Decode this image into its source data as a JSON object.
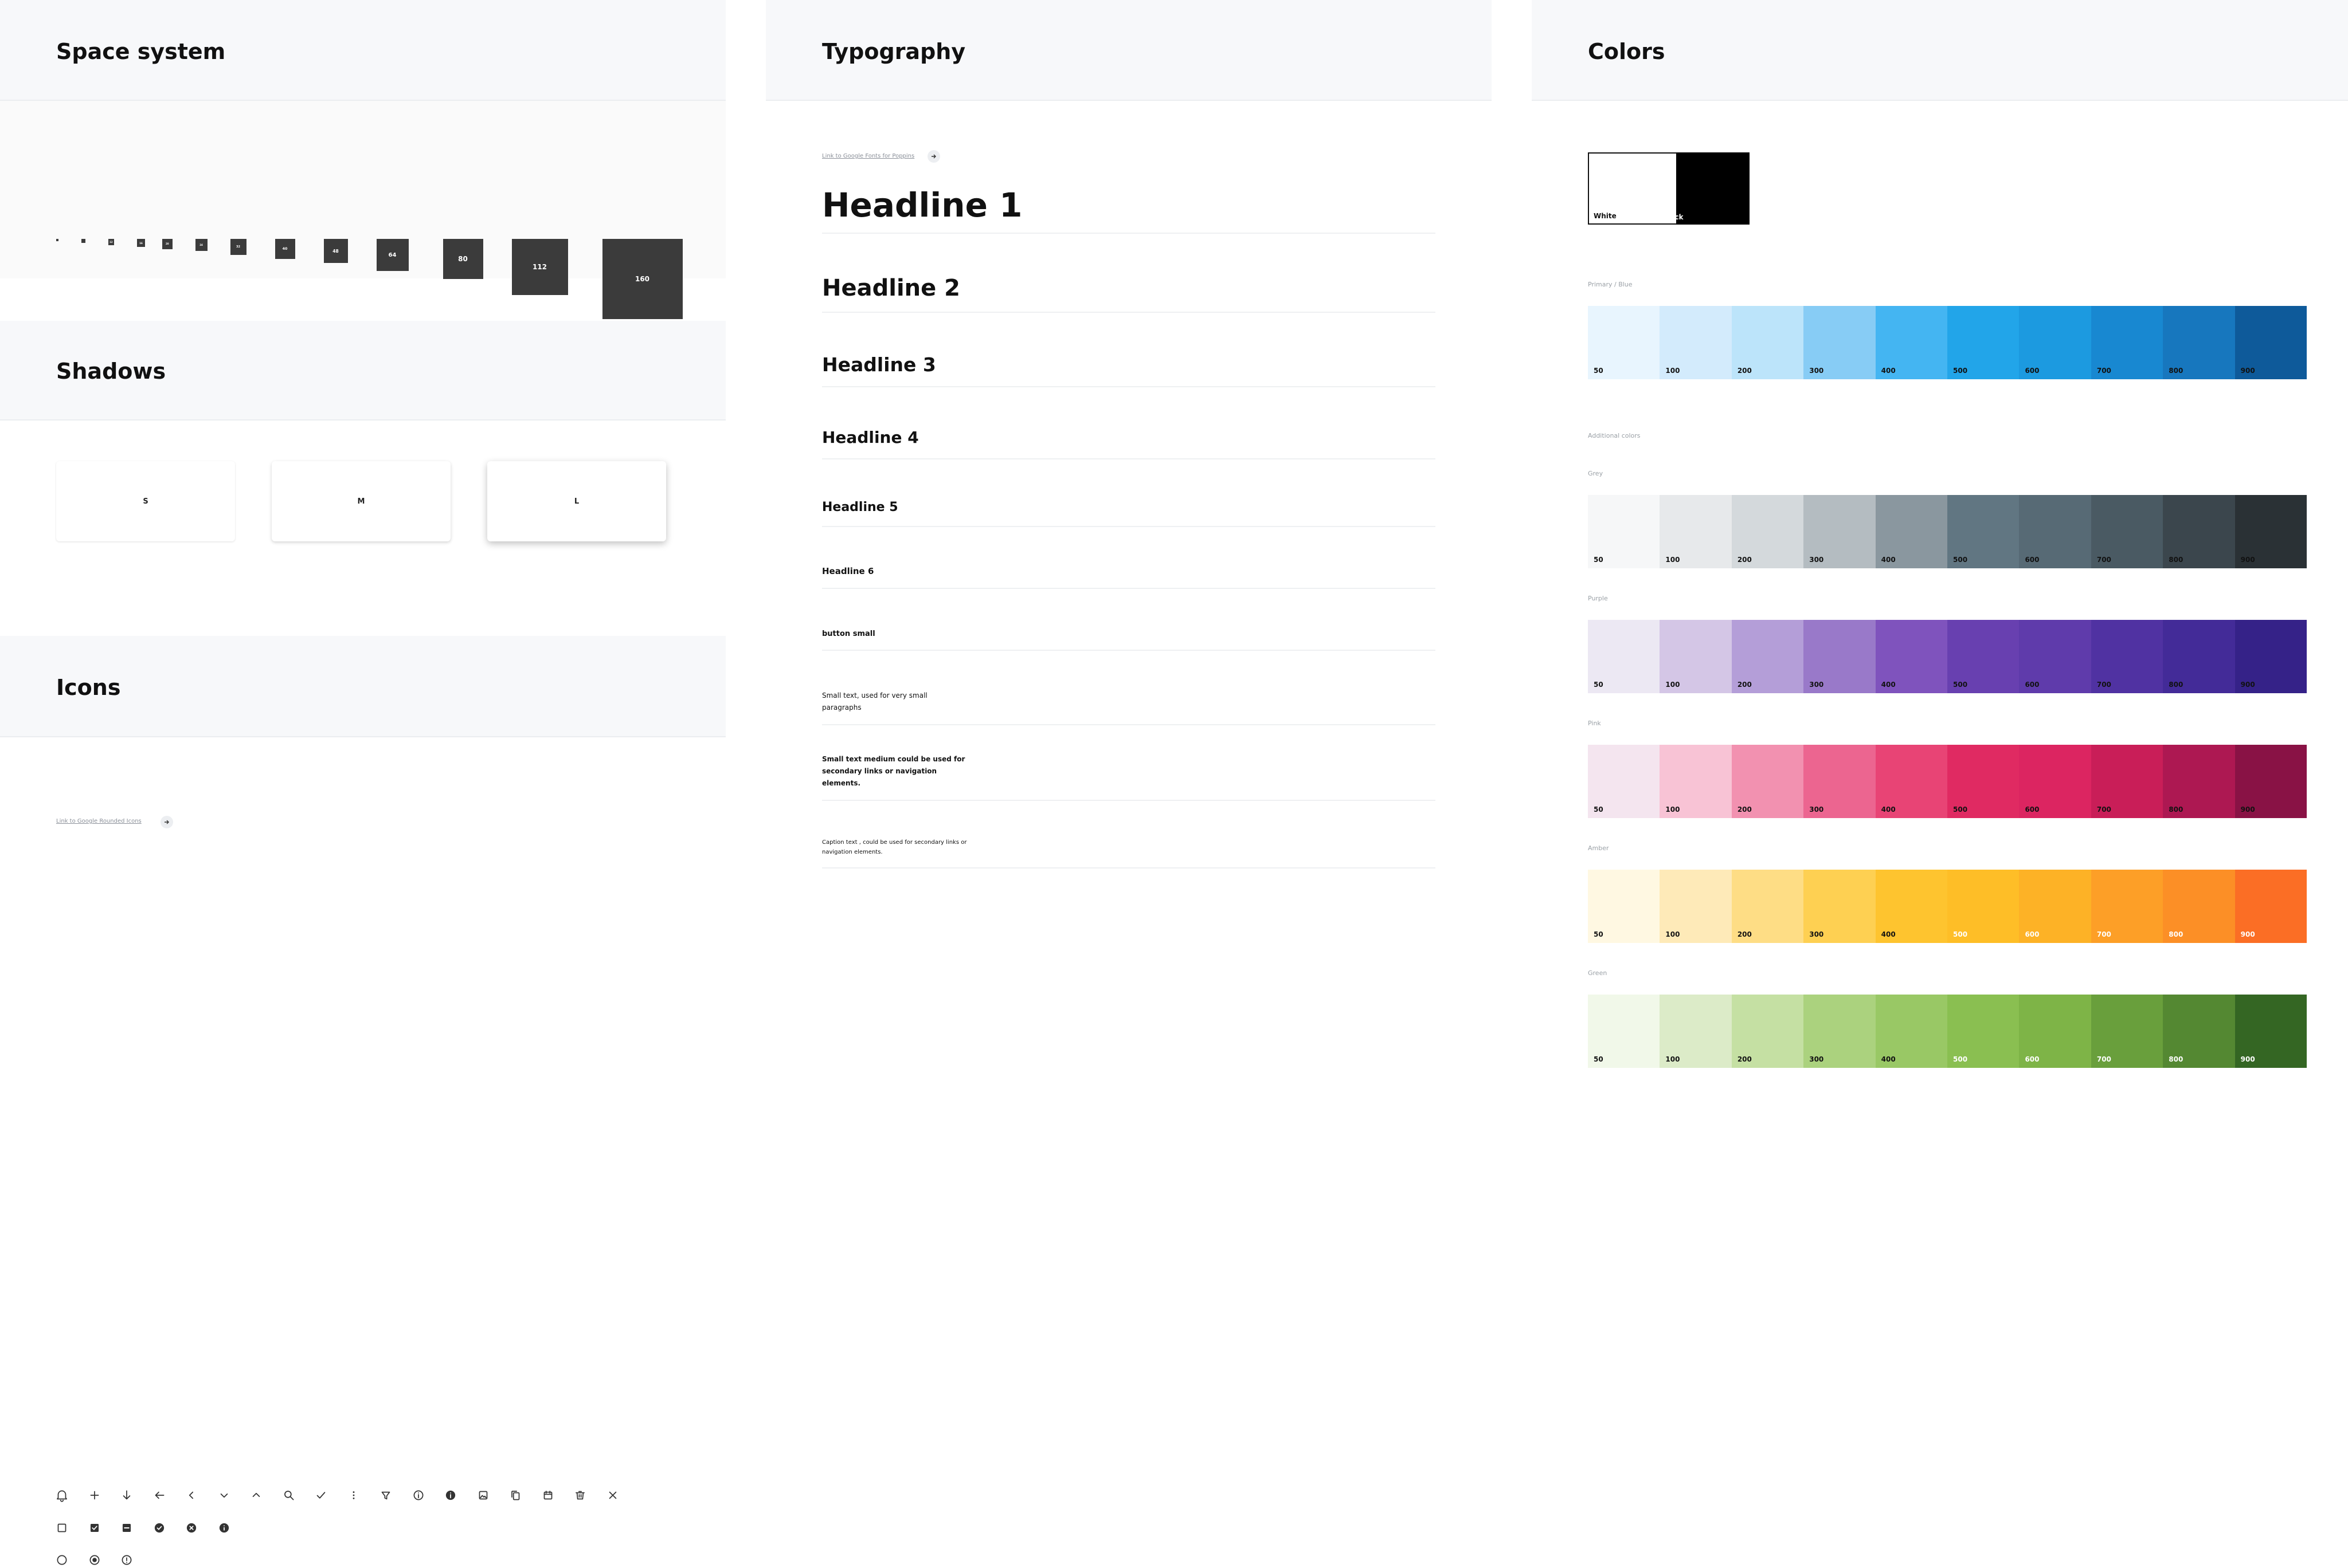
{
  "space": {
    "title": "Space system",
    "items": [
      "4",
      "8",
      "12",
      "16",
      "20",
      "24",
      "32",
      "40",
      "48",
      "64",
      "80",
      "112",
      "160"
    ]
  },
  "shadows": {
    "title": "Shadows",
    "items": [
      "S",
      "M",
      "L"
    ]
  },
  "icons": {
    "title": "Icons",
    "link_text": "Link to Google Rounded Icons",
    "row1": [
      "bell-icon",
      "plus-icon",
      "arrow-down-icon",
      "arrow-left-icon",
      "chevron-left-icon",
      "chevron-down-icon",
      "chevron-up-icon",
      "search-icon",
      "check-icon",
      "more-vert-icon",
      "filter-icon",
      "info-outline-icon",
      "info-filled-icon",
      "image-icon",
      "copy-icon",
      "calendar-icon",
      "trash-icon",
      "close-icon"
    ],
    "row2": [
      "checkbox-empty-icon",
      "checkbox-checked-icon",
      "checkbox-indeterminate-icon",
      "check-circle-icon",
      "cancel-circle-icon",
      "info-circle-icon"
    ],
    "row3": [
      "radio-empty-icon",
      "radio-selected-icon",
      "alert-circle-icon"
    ]
  },
  "typography": {
    "title": "Typography",
    "link_text": "Link to Google Fonts for Poppins",
    "items": [
      {
        "text": "Headline 1"
      },
      {
        "text": "Headline 2"
      },
      {
        "text": "Headline 3"
      },
      {
        "text": "Headline 4"
      },
      {
        "text": "Headline 5"
      },
      {
        "text": "Headline 6"
      },
      {
        "text": "button small"
      },
      {
        "text": "Small text, used for very small paragraphs"
      },
      {
        "text": "Small text medium could be used for secondary links or navigation elements."
      },
      {
        "text": "Caption text , could be used for secondary links or navigation elements."
      }
    ]
  },
  "colors": {
    "title": "Colors",
    "white_label": "White",
    "black_label": "Black",
    "additional_label": "Additional colors",
    "palettes": [
      {
        "name": "Primary / Blue",
        "swatches": [
          "#e8f5fe",
          "#d3ebfc",
          "#bce4fa",
          "#87ccf5",
          "#44b5f2",
          "#22a5e9",
          "#1c9ae0",
          "#1888d1",
          "#1777be",
          "#0e5a9a"
        ],
        "light_text_from": 99
      },
      {
        "name": "Grey",
        "swatches": [
          "#f6f7f8",
          "#e7e9eb",
          "#d4d9dc",
          "#b4bcc1",
          "#8a979f",
          "#617682",
          "#576a75",
          "#4a5a63",
          "#3b464d",
          "#2a3135"
        ],
        "light_text_from": 99
      },
      {
        "name": "Purple",
        "swatches": [
          "#ece8f3",
          "#d4c6e6",
          "#b49ed8",
          "#9979c9",
          "#7f53bd",
          "#6840b0",
          "#5f3bab",
          "#5032a2",
          "#432b98",
          "#352288"
        ],
        "light_text_from": 99
      },
      {
        "name": "Pink",
        "swatches": [
          "#f4e5ef",
          "#f8c3d5",
          "#f291b0",
          "#ec6590",
          "#e84475",
          "#e02a62",
          "#dc2561",
          "#c91e58",
          "#ad1852",
          "#891245"
        ],
        "light_text_from": 99
      },
      {
        "name": "Amber",
        "swatches": [
          "#fff8e2",
          "#feeab8",
          "#fedd85",
          "#fed052",
          "#fec42f",
          "#febe27",
          "#fdb226",
          "#fd9f27",
          "#fc8f26",
          "#fb6e25"
        ],
        "light_text_from": 5
      },
      {
        "name": "Green",
        "swatches": [
          "#f1f8e9",
          "#dcebc8",
          "#c5e0a3",
          "#abd27e",
          "#99c865",
          "#8abf51",
          "#7eb447",
          "#699f3c",
          "#548832",
          "#346623"
        ],
        "light_text_from": 5
      }
    ],
    "steps": [
      "50",
      "100",
      "200",
      "300",
      "400",
      "500",
      "600",
      "700",
      "800",
      "900"
    ]
  }
}
